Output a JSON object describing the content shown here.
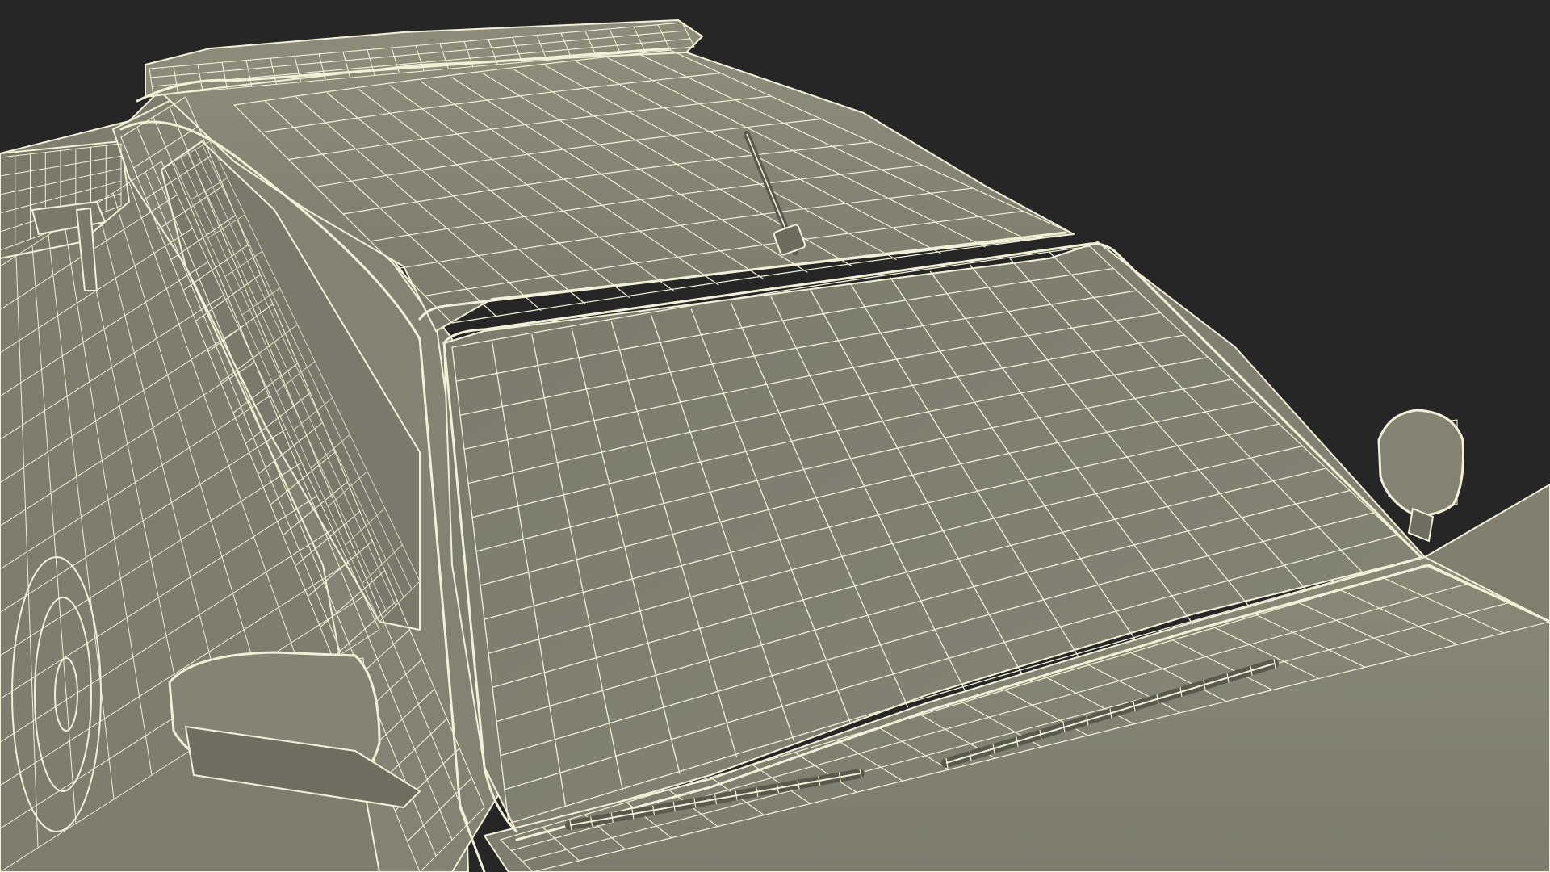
{
  "viewport": {
    "background": "#262626"
  },
  "scene": {
    "subject": "wireframe-pickup-truck-front-cab",
    "colors": {
      "surface": "#858474",
      "surface_dark": "#6f6e60",
      "surface_light": "#9a9987",
      "glass": "#7f7e6e",
      "wire": "#f2f0d6",
      "wire_soft": "#d9d7bd",
      "edge": "#4a4a40"
    }
  }
}
